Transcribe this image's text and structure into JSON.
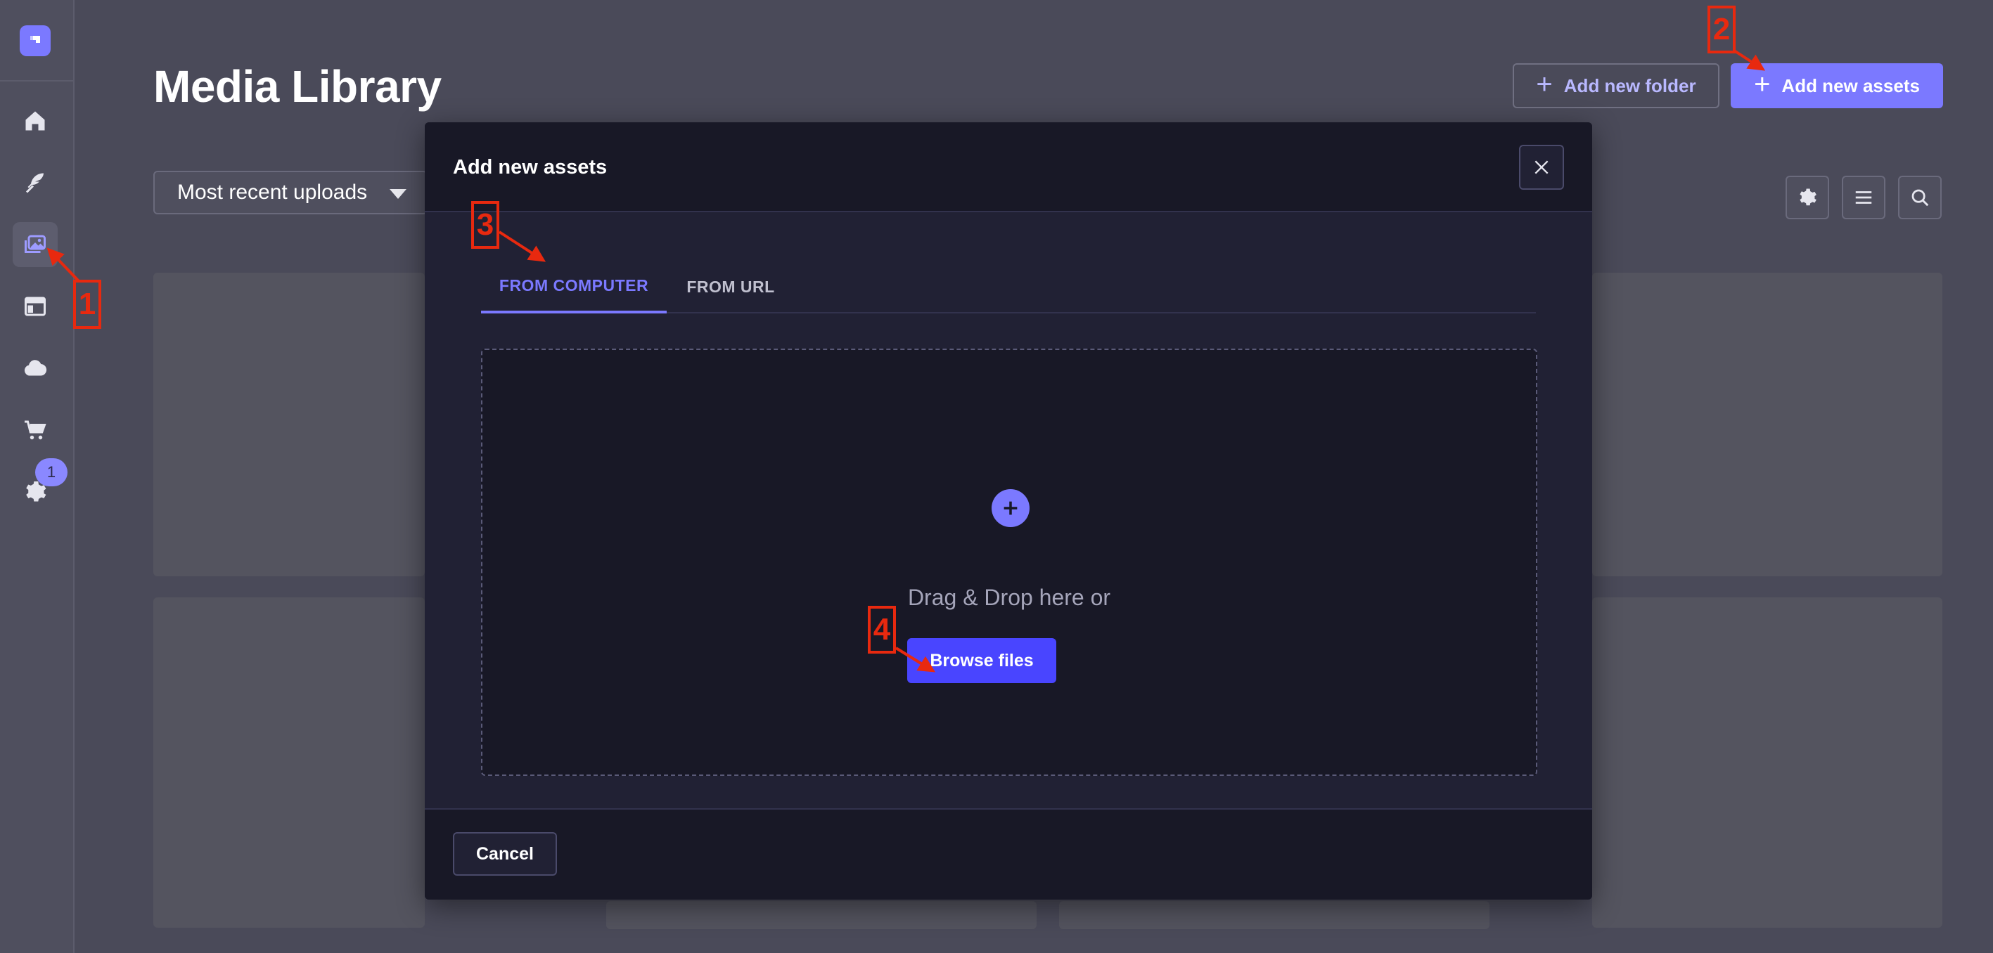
{
  "sidebar": {
    "items": [
      {
        "name": "home",
        "icon": "home-icon"
      },
      {
        "name": "content-manager",
        "icon": "feather-icon"
      },
      {
        "name": "media-library",
        "icon": "images-icon",
        "active": true
      },
      {
        "name": "content-type-builder",
        "icon": "layout-icon"
      },
      {
        "name": "cloud",
        "icon": "cloud-icon"
      },
      {
        "name": "marketplace",
        "icon": "cart-icon"
      },
      {
        "name": "settings",
        "icon": "gear-icon"
      }
    ],
    "settings_badge": "1"
  },
  "header": {
    "title": "Media Library",
    "add_folder_label": "Add new folder",
    "add_assets_label": "Add new assets"
  },
  "filters": {
    "sort_value": "Most recent uploads"
  },
  "modal": {
    "title": "Add new assets",
    "tabs": [
      {
        "label": "FROM COMPUTER",
        "active": true
      },
      {
        "label": "FROM URL",
        "active": false
      }
    ],
    "dropzone_text": "Drag & Drop here or",
    "browse_label": "Browse files",
    "cancel_label": "Cancel"
  },
  "annotations": [
    {
      "number": "1"
    },
    {
      "number": "2"
    },
    {
      "number": "3"
    },
    {
      "number": "4"
    }
  ],
  "colors": {
    "accent": "#7b79ff",
    "primary_button": "#4945ff",
    "annotation": "#e8290f"
  }
}
